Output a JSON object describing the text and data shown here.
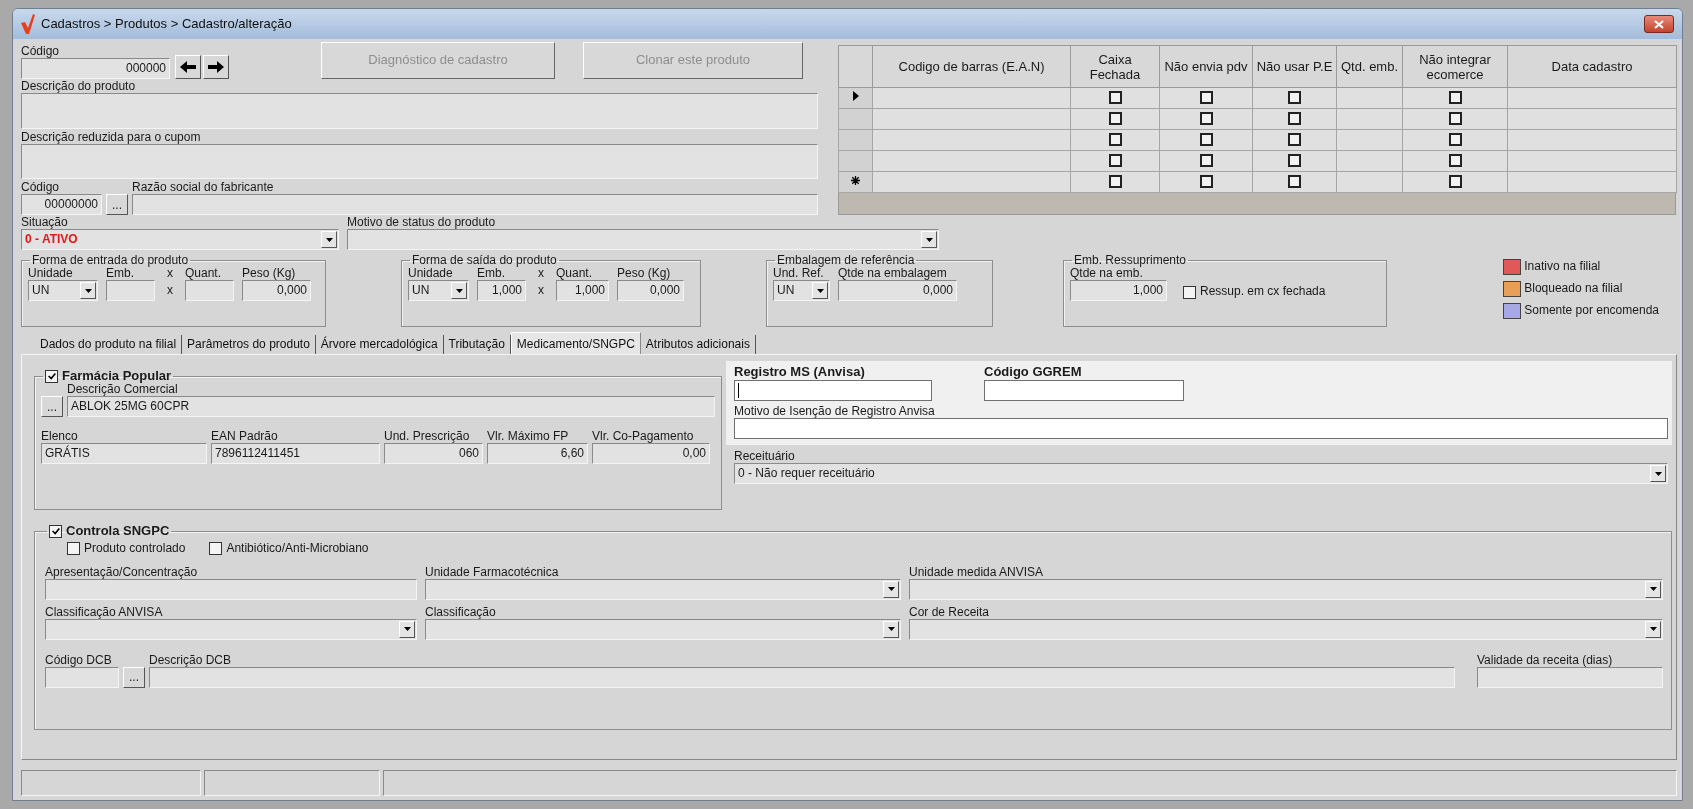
{
  "window": {
    "title": "Cadastros > Produtos > Cadastro/alteração"
  },
  "header": {
    "codigo": {
      "label": "Código",
      "value": "000000",
      "kind": "number"
    },
    "actions": [
      {
        "label": "Diagnóstico de cadastro",
        "disabled": true
      },
      {
        "label": "Clonar este produto",
        "disabled": true
      }
    ],
    "descricao": {
      "label": "Descrição  do produto"
    },
    "descricao_reduzida": {
      "label": "Descrição reduzida para o cupom"
    },
    "fabricante_codigo": {
      "label": "Código",
      "value": "00000000",
      "kind": "number",
      "lookup_button": "..."
    },
    "fabricante_razao": {
      "label": "Razão social do fabricante"
    },
    "situacao": {
      "label": "Situação",
      "value": "0 - ATIVO",
      "kind": "select"
    },
    "motivo_status": {
      "label": "Motivo de status do produto",
      "kind": "select"
    }
  },
  "barcodes": {
    "columns": [
      "Codigo de barras (E.A.N)",
      "Caixa Fechada",
      "Não envia pdv",
      "Não usar P.E",
      "Qtd. emb.",
      "Não integrar ecomerce",
      "Data cadastro"
    ],
    "rows": [
      {
        "kind": "current",
        "caixa_fechada": false,
        "nao_envia_pdv": false,
        "nao_usar_pe": false,
        "nao_integrar_ecomerce": false
      },
      {
        "kind": "blank",
        "caixa_fechada": false,
        "nao_envia_pdv": false,
        "nao_usar_pe": false,
        "nao_integrar_ecomerce": false
      },
      {
        "kind": "blank",
        "caixa_fechada": false,
        "nao_envia_pdv": false,
        "nao_usar_pe": false,
        "nao_integrar_ecomerce": false
      },
      {
        "kind": "blank",
        "caixa_fechada": false,
        "nao_envia_pdv": false,
        "nao_usar_pe": false,
        "nao_integrar_ecomerce": false
      },
      {
        "kind": "new",
        "caixa_fechada": false,
        "nao_envia_pdv": false,
        "nao_usar_pe": false,
        "nao_integrar_ecomerce": false
      }
    ]
  },
  "groups": [
    {
      "title": "Forma de entrada do produto",
      "fields": [
        {
          "label": "Unidade",
          "kind": "select",
          "value": "UN"
        },
        {
          "label": "Emb.",
          "kind": "number"
        },
        {
          "kind": "times",
          "label": "x",
          "value": "x"
        },
        {
          "label": "Quant.",
          "kind": "number"
        },
        {
          "label": "Peso (Kg)",
          "kind": "number",
          "value": "0,000"
        }
      ]
    },
    {
      "title": "Forma de saída do produto",
      "fields": [
        {
          "label": "Unidade",
          "kind": "select",
          "value": "UN"
        },
        {
          "label": "Emb.",
          "kind": "number",
          "value": "1,000"
        },
        {
          "kind": "times",
          "label": "x",
          "value": "x"
        },
        {
          "label": "Quant.",
          "kind": "number",
          "value": "1,000"
        },
        {
          "label": "Peso (Kg)",
          "kind": "number",
          "value": "0,000"
        }
      ]
    },
    {
      "title": "Embalagem de referência",
      "fields": [
        {
          "label": "Und. Ref.",
          "kind": "select",
          "value": "UN"
        },
        {
          "label": "Qtde na embalagem",
          "kind": "number",
          "value": "0,000"
        }
      ]
    },
    {
      "title": "Emb. Ressuprimento",
      "fields": [
        {
          "label": "Qtde na emb.",
          "kind": "number",
          "value": "1,000"
        },
        {
          "label": "Ressup. em cx fechada",
          "kind": "checkbox",
          "checked": false
        }
      ]
    }
  ],
  "legend": [
    {
      "label": "Inativo na filial",
      "color": "#e05858"
    },
    {
      "label": "Bloqueado na filial",
      "color": "#e8a058"
    },
    {
      "label": "Somente por encomenda",
      "color": "#a8a8e4"
    }
  ],
  "tabs": [
    {
      "label": "Dados do produto na filial",
      "selected": false
    },
    {
      "label": "Parâmetros do produto",
      "selected": false
    },
    {
      "label": "Árvore mercadológica",
      "selected": false
    },
    {
      "label": "Tributação",
      "selected": false
    },
    {
      "label": "Medicamento/SNGPC",
      "selected": true
    },
    {
      "label": "Atributos adicionais",
      "selected": false
    }
  ],
  "farmacia_popular": {
    "title": "Farmácia Popular",
    "checked": true,
    "descricao_comercial": {
      "label": "Descrição Comercial",
      "value": "ABLOK 25MG 60CPR",
      "lookup_button": "..."
    },
    "fields": [
      {
        "label": "Elenco",
        "value": "GRÁTIS"
      },
      {
        "label": "EAN Padrão",
        "value": "7896112411451"
      },
      {
        "label": "Und. Prescrição",
        "value": "060",
        "kind": "number"
      },
      {
        "label": "Vlr. Máximo FP",
        "value": "6,60",
        "kind": "number"
      },
      {
        "label": "Vlr. Co-Pagamento",
        "value": "0,00",
        "kind": "number"
      }
    ]
  },
  "registro": {
    "registro_ms": {
      "label": "Registro MS (Anvisa)"
    },
    "codigo_ggrem": {
      "label": "Código GGREM"
    },
    "motivo_isencao": {
      "label": "Motivo de Isenção de Registro Anvisa"
    },
    "receituario": {
      "label": "Receituário",
      "value": "0 - Não requer receituário",
      "kind": "select"
    }
  },
  "sngpc": {
    "title": "Controla SNGPC",
    "checked": true,
    "options": [
      {
        "label": "Produto controlado",
        "checked": false
      },
      {
        "label": "Antibiótico/Anti-Microbiano",
        "checked": false
      }
    ],
    "fields": [
      {
        "label": "Apresentação/Concentração",
        "kind": "text"
      },
      {
        "label": "Unidade Farmacotécnica",
        "kind": "select"
      },
      {
        "label": "Unidade medida ANVISA",
        "kind": "select"
      },
      {
        "label": "Classificação ANVISA",
        "kind": "select"
      },
      {
        "label": "Classificação",
        "kind": "select"
      },
      {
        "label": "Cor de  Receita",
        "kind": "select"
      },
      {
        "label": "Código DCB",
        "kind": "text",
        "lookup_button": "..."
      },
      {
        "label": "Descrição DCB",
        "kind": "text"
      },
      {
        "label": "Validade da receita (dias)",
        "kind": "text"
      }
    ]
  }
}
